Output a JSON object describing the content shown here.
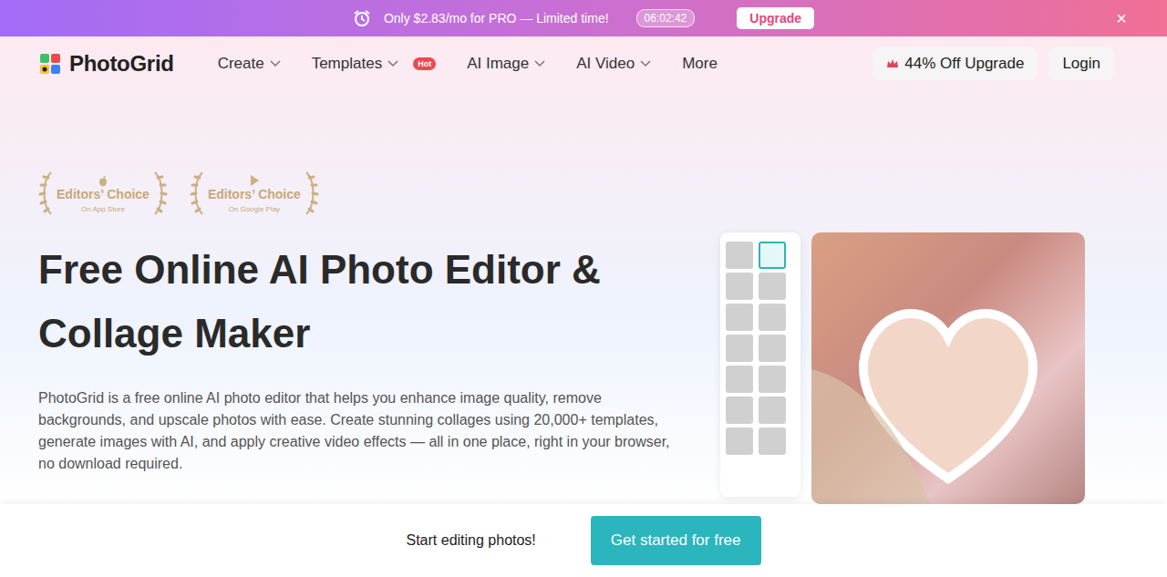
{
  "promo": {
    "text": "Only $2.83/mo for PRO — Limited time!",
    "countdown": "06:02:42",
    "button": "Upgrade",
    "close": "×"
  },
  "brand": "PhotoGrid",
  "nav": [
    {
      "label": "Create",
      "dropdown": true,
      "badge": ""
    },
    {
      "label": "Templates",
      "dropdown": true,
      "badge": "Hot"
    },
    {
      "label": "AI Image",
      "dropdown": true,
      "badge": ""
    },
    {
      "label": "AI Video",
      "dropdown": true,
      "badge": ""
    },
    {
      "label": "More",
      "dropdown": false,
      "badge": ""
    }
  ],
  "upgrade_button": "44% Off Upgrade",
  "login": "Login",
  "awards": [
    {
      "title": "Editors’ Choice",
      "store": "On App Store",
      "kind": "apple"
    },
    {
      "title": "Editors’ Choice",
      "store": "On Google Play",
      "kind": "play"
    }
  ],
  "hero": {
    "title": "Free Online AI Photo Editor & Collage Maker",
    "description": "PhotoGrid is a free online AI photo editor that helps you enhance image quality, remove backgrounds, and upscale photos with ease. Create stunning collages using 20,000+ templates, generate images with AI, and apply creative video effects — all in one place, right in your browser, no download required."
  },
  "cta_bar": {
    "text": "Start editing photos!",
    "button": "Get started for free"
  }
}
